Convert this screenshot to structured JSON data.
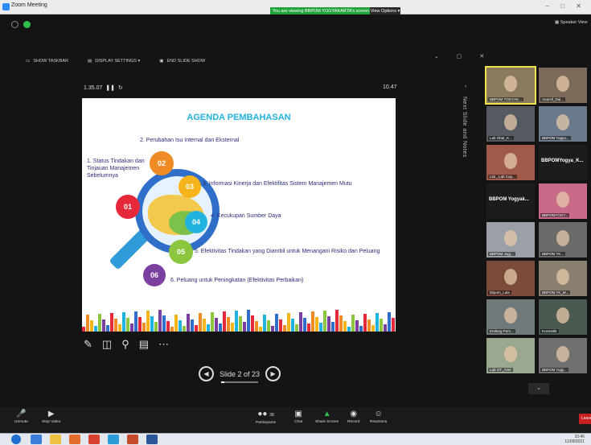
{
  "window": {
    "title": "Zoom Meeting",
    "banner": "You are viewing BBPOM YOGYAKARTA's screen",
    "view_options": "View Options ▾",
    "speaker_view": "Speaker View"
  },
  "slideshow_bar": {
    "show_taskbar": "SHOW TASKBAR",
    "display_settings": "DISPLAY SETTINGS ▾",
    "end_slide_show": "END SLIDE SHOW"
  },
  "presenter": {
    "elapsed": "1.35.07",
    "clock": "10.47",
    "notes_label": "Next Slide and Notes",
    "slide_counter": "Slide 2 of 23",
    "progress_fraction": 0.087
  },
  "slide": {
    "title": "AGENDA PEMBAHASAN",
    "items": [
      {
        "num": "01",
        "color": "#e5283a",
        "text": "1. Status Tindakan dan Tinjauan Manajemen Sebelumnya"
      },
      {
        "num": "02",
        "color": "#f08a24",
        "text": "2. Perubahan Isu Internal dan Eksternal"
      },
      {
        "num": "03",
        "color": "#f4b41a",
        "text": "3. Informasi Kinerja dan Efektifitas Sistem Manajemen Mutu"
      },
      {
        "num": "04",
        "color": "#21b3e0",
        "text": "4. Kecukupan Sumber Daya"
      },
      {
        "num": "05",
        "color": "#8cc63f",
        "text": "5. Efektivitas Tindakan yang Diambil untuk Menangani Risiko dan Peluang"
      },
      {
        "num": "06",
        "color": "#7b3fa0",
        "text": "6. Peluang  untuk  Peningkatan (Efektivitas Perbaikan)"
      }
    ]
  },
  "gallery": [
    {
      "label": "BBPOM YOGYAK...",
      "type": "video",
      "color": "#8a7a60",
      "active": true
    },
    {
      "label": "Anarsif_Dal...",
      "type": "video",
      "color": "#7b6a5a"
    },
    {
      "label": "Lab Obat_K...",
      "type": "video",
      "color": "#555a60"
    },
    {
      "label": "BBPOM Yogya...",
      "type": "video",
      "color": "#6a7a8a"
    },
    {
      "label": "Lita _Lab Cup...",
      "type": "video",
      "color": "#a05a4a"
    },
    {
      "label": "",
      "type": "name",
      "name": "BBPOMYogya_K..."
    },
    {
      "label": "",
      "type": "name",
      "name": "BBPOM Yogyak..."
    },
    {
      "label": "BBPOMYOGY...",
      "type": "video",
      "color": "#c86a8a"
    },
    {
      "label": "BBPOM Jogj...",
      "type": "video",
      "color": "#9aa0a6"
    },
    {
      "label": "BBPOM YK...",
      "type": "video",
      "color": "#6a6a6a"
    },
    {
      "label": "bbpom_Lala",
      "type": "video",
      "color": "#7a4a3a"
    },
    {
      "label": "BBPOM YK_M...",
      "type": "video",
      "color": "#8a8070"
    },
    {
      "label": "Endang Pem...",
      "type": "video",
      "color": "#707a7a"
    },
    {
      "label": "Kosmetik",
      "type": "video",
      "color": "#4a5a50"
    },
    {
      "label": "Lab OT_Ariel",
      "type": "video",
      "color": "#9aa890"
    },
    {
      "label": "BBPOM Yogy...",
      "type": "video",
      "color": "#707070"
    }
  ],
  "toolbar": {
    "unmute": "Unmute",
    "stop_video": "Stop Video",
    "participants": "Participants",
    "participants_count": "38",
    "chat": "Chat",
    "share_screen": "Share Screen",
    "record": "Record",
    "reactions": "Reactions",
    "leave": "Leave"
  },
  "tray": {
    "time": "10:46",
    "date": "11/09/2021"
  }
}
